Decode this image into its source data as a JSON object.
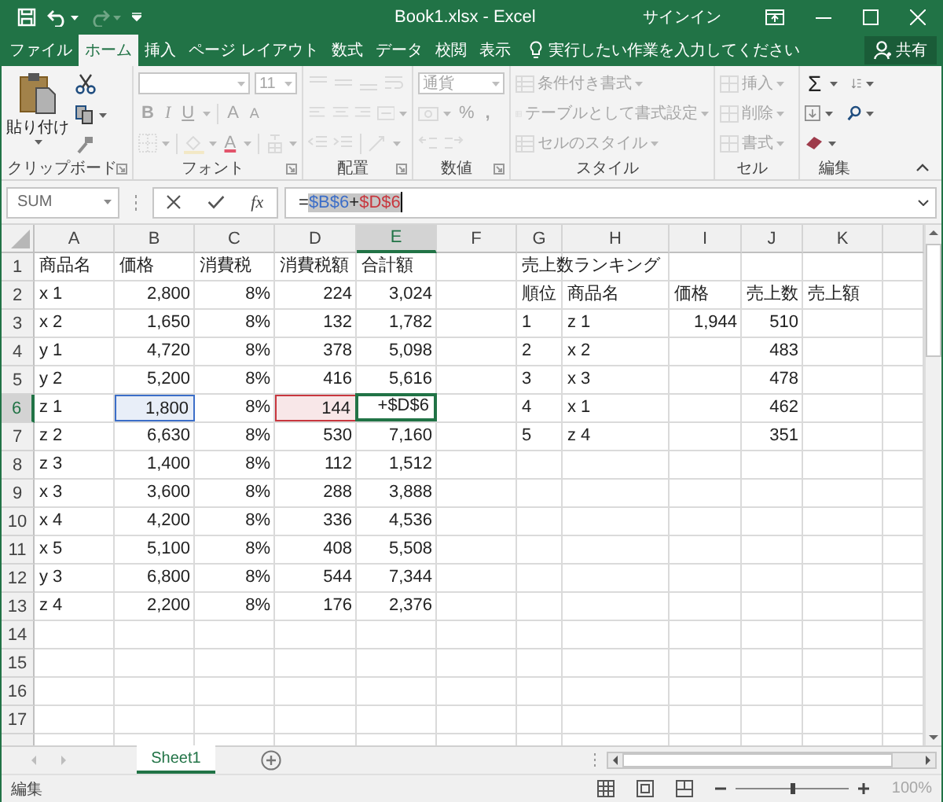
{
  "window": {
    "title": "Book1.xlsx - Excel",
    "signin": "サインイン"
  },
  "tabs": [
    {
      "label": "ファイル",
      "selected": false
    },
    {
      "label": "ホーム",
      "selected": true
    },
    {
      "label": "挿入",
      "selected": false
    },
    {
      "label": "ページ レイアウト",
      "selected": false
    },
    {
      "label": "数式",
      "selected": false
    },
    {
      "label": "データ",
      "selected": false
    },
    {
      "label": "校閲",
      "selected": false
    },
    {
      "label": "表示",
      "selected": false
    }
  ],
  "tell_me": {
    "placeholder": "実行したい作業を入力してください"
  },
  "share_button": "共有",
  "ribbon": {
    "clipboard": {
      "label": "クリップボード",
      "paste": "貼り付け",
      "disabled": false
    },
    "font": {
      "label": "フォント",
      "size": "11",
      "styles": [
        "B",
        "I",
        "U"
      ],
      "size_buttons": [
        "A",
        "A"
      ],
      "color_button": "A",
      "disabled": true
    },
    "alignment": {
      "label": "配置",
      "disabled": true
    },
    "number": {
      "label": "数値",
      "format": "通貨",
      "percent": "%",
      "comma": ",",
      "disabled": true
    },
    "styles": {
      "label": "スタイル",
      "items": [
        "条件付き書式",
        "テーブルとして書式設定",
        "セルのスタイル"
      ],
      "disabled": true
    },
    "cells": {
      "label": "セル",
      "items": [
        "挿入",
        "削除",
        "書式"
      ],
      "disabled": true
    },
    "editing": {
      "label": "編集",
      "autosum": "Σ",
      "disabled": false
    }
  },
  "formula_bar": {
    "name_box": "SUM",
    "function_button": "fx",
    "formula": [
      {
        "text": "=",
        "selected": false
      },
      {
        "text": "$B$6",
        "color": "#3c6ec8",
        "selected": true
      },
      {
        "text": "+",
        "selected": true
      },
      {
        "text": "$D$6",
        "color": "#c8373e",
        "selected": true
      }
    ]
  },
  "sheet": {
    "columns": [
      {
        "label": "A",
        "selected": false
      },
      {
        "label": "B",
        "selected": false
      },
      {
        "label": "C",
        "selected": false
      },
      {
        "label": "D",
        "selected": false
      },
      {
        "label": "E",
        "selected": true
      },
      {
        "label": "F",
        "selected": false
      },
      {
        "label": "G",
        "selected": false
      },
      {
        "label": "H",
        "selected": false
      },
      {
        "label": "I",
        "selected": false
      },
      {
        "label": "J",
        "selected": false
      },
      {
        "label": "K",
        "selected": false
      }
    ],
    "rows": [
      {
        "number": "1",
        "selected": false,
        "cells": [
          {
            "kind": "text",
            "text": "商品名"
          },
          {
            "kind": "text",
            "text": "価格"
          },
          {
            "kind": "text",
            "text": "消費税"
          },
          {
            "kind": "text",
            "text": "消費税額"
          },
          {
            "kind": "text",
            "text": "合計額"
          },
          {
            "kind": "empty"
          },
          {
            "kind": "text",
            "text": "売上数ランキング"
          }
        ]
      },
      {
        "number": "2",
        "selected": false,
        "cells": [
          {
            "kind": "text",
            "text": "x 1"
          },
          {
            "kind": "number",
            "text": "2,800"
          },
          {
            "kind": "number",
            "text": "8%"
          },
          {
            "kind": "number",
            "text": "224"
          },
          {
            "kind": "number",
            "text": "3,024"
          },
          {
            "kind": "empty"
          },
          {
            "kind": "text",
            "text": "順位"
          },
          {
            "kind": "text",
            "text": "商品名"
          },
          {
            "kind": "text",
            "text": "価格"
          },
          {
            "kind": "text",
            "text": "売上数"
          },
          {
            "kind": "text",
            "text": "売上額"
          }
        ]
      },
      {
        "number": "3",
        "selected": false,
        "cells": [
          {
            "kind": "text",
            "text": "x 2"
          },
          {
            "kind": "number",
            "text": "1,650"
          },
          {
            "kind": "number",
            "text": "8%"
          },
          {
            "kind": "number",
            "text": "132"
          },
          {
            "kind": "number",
            "text": "1,782"
          },
          {
            "kind": "empty"
          },
          {
            "kind": "text",
            "text": "1"
          },
          {
            "kind": "text",
            "text": "z 1"
          },
          {
            "kind": "number",
            "text": "1,944"
          },
          {
            "kind": "number",
            "text": "510"
          }
        ]
      },
      {
        "number": "4",
        "selected": false,
        "cells": [
          {
            "kind": "text",
            "text": "y 1"
          },
          {
            "kind": "number",
            "text": "4,720"
          },
          {
            "kind": "number",
            "text": "8%"
          },
          {
            "kind": "number",
            "text": "378"
          },
          {
            "kind": "number",
            "text": "5,098"
          },
          {
            "kind": "empty"
          },
          {
            "kind": "text",
            "text": "2"
          },
          {
            "kind": "text",
            "text": "x 2"
          },
          {
            "kind": "empty"
          },
          {
            "kind": "number",
            "text": "483"
          }
        ]
      },
      {
        "number": "5",
        "selected": false,
        "cells": [
          {
            "kind": "text",
            "text": "y 2"
          },
          {
            "kind": "number",
            "text": "5,200"
          },
          {
            "kind": "number",
            "text": "8%"
          },
          {
            "kind": "number",
            "text": "416"
          },
          {
            "kind": "number",
            "text": "5,616"
          },
          {
            "kind": "empty"
          },
          {
            "kind": "text",
            "text": "3"
          },
          {
            "kind": "text",
            "text": "x 3"
          },
          {
            "kind": "empty"
          },
          {
            "kind": "number",
            "text": "478"
          }
        ]
      },
      {
        "number": "6",
        "selected": true,
        "cells": [
          {
            "kind": "text",
            "text": "z 1"
          },
          {
            "kind": "number",
            "text": "1,800",
            "color": "#3c6ec8"
          },
          {
            "kind": "number",
            "text": "8%"
          },
          {
            "kind": "number",
            "text": "144",
            "color": "#c8373e"
          },
          {
            "kind": "editing",
            "text": "+$D$6"
          },
          {
            "kind": "empty"
          },
          {
            "kind": "text",
            "text": "4"
          },
          {
            "kind": "text",
            "text": "x 1"
          },
          {
            "kind": "empty"
          },
          {
            "kind": "number",
            "text": "462"
          }
        ]
      },
      {
        "number": "7",
        "selected": false,
        "cells": [
          {
            "kind": "text",
            "text": "z 2"
          },
          {
            "kind": "number",
            "text": "6,630"
          },
          {
            "kind": "number",
            "text": "8%"
          },
          {
            "kind": "number",
            "text": "530"
          },
          {
            "kind": "number",
            "text": "7,160"
          },
          {
            "kind": "empty"
          },
          {
            "kind": "text",
            "text": "5"
          },
          {
            "kind": "text",
            "text": "z 4"
          },
          {
            "kind": "empty"
          },
          {
            "kind": "number",
            "text": "351"
          }
        ]
      },
      {
        "number": "8",
        "selected": false,
        "cells": [
          {
            "kind": "text",
            "text": "z 3"
          },
          {
            "kind": "number",
            "text": "1,400"
          },
          {
            "kind": "number",
            "text": "8%"
          },
          {
            "kind": "number",
            "text": "112"
          },
          {
            "kind": "number",
            "text": "1,512"
          }
        ]
      },
      {
        "number": "9",
        "selected": false,
        "cells": [
          {
            "kind": "text",
            "text": "x 3"
          },
          {
            "kind": "number",
            "text": "3,600"
          },
          {
            "kind": "number",
            "text": "8%"
          },
          {
            "kind": "number",
            "text": "288"
          },
          {
            "kind": "number",
            "text": "3,888"
          }
        ]
      },
      {
        "number": "10",
        "selected": false,
        "cells": [
          {
            "kind": "text",
            "text": "x 4"
          },
          {
            "kind": "number",
            "text": "4,200"
          },
          {
            "kind": "number",
            "text": "8%"
          },
          {
            "kind": "number",
            "text": "336"
          },
          {
            "kind": "number",
            "text": "4,536"
          }
        ]
      },
      {
        "number": "11",
        "selected": false,
        "cells": [
          {
            "kind": "text",
            "text": "x 5"
          },
          {
            "kind": "number",
            "text": "5,100"
          },
          {
            "kind": "number",
            "text": "8%"
          },
          {
            "kind": "number",
            "text": "408"
          },
          {
            "kind": "number",
            "text": "5,508"
          }
        ]
      },
      {
        "number": "12",
        "selected": false,
        "cells": [
          {
            "kind": "text",
            "text": "y 3"
          },
          {
            "kind": "number",
            "text": "6,800"
          },
          {
            "kind": "number",
            "text": "8%"
          },
          {
            "kind": "number",
            "text": "544"
          },
          {
            "kind": "number",
            "text": "7,344"
          }
        ]
      },
      {
        "number": "13",
        "selected": false,
        "cells": [
          {
            "kind": "text",
            "text": "z 4"
          },
          {
            "kind": "number",
            "text": "2,200"
          },
          {
            "kind": "number",
            "text": "8%"
          },
          {
            "kind": "number",
            "text": "176"
          },
          {
            "kind": "number",
            "text": "2,376"
          }
        ]
      },
      {
        "number": "14",
        "selected": false
      },
      {
        "number": "15",
        "selected": false
      },
      {
        "number": "16",
        "selected": false
      },
      {
        "number": "17",
        "selected": false
      }
    ]
  },
  "sheet_tabs": [
    {
      "label": "Sheet1",
      "selected": true
    }
  ],
  "status_bar": {
    "mode": "編集",
    "zoom": {
      "level": 0.5,
      "reading": "100%"
    }
  }
}
